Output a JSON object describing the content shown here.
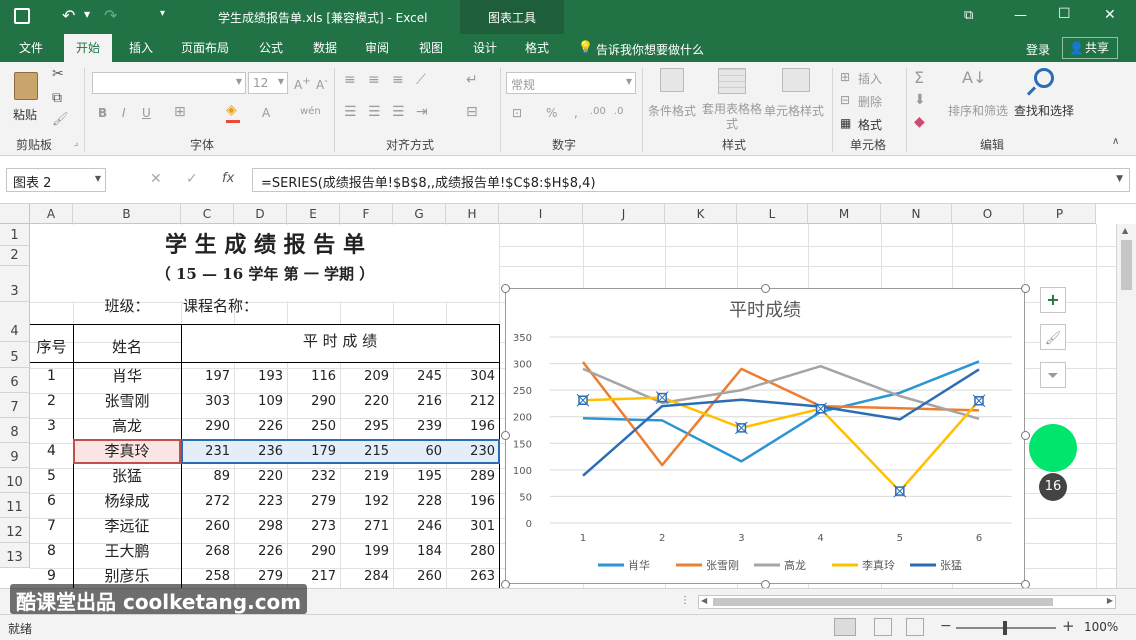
{
  "window": {
    "title": "学生成绩报告单.xls  [兼容模式] - Excel",
    "context_tab": "图表工具",
    "buttons": {
      "restore": "⧉",
      "minimize": "—",
      "maximize": "☐",
      "close": "✕"
    }
  },
  "tabs": [
    "文件",
    "开始",
    "插入",
    "页面布局",
    "公式",
    "数据",
    "审阅",
    "视图",
    "设计",
    "格式"
  ],
  "active_tab": "开始",
  "tell_me": "告诉我你想要做什么",
  "login": "登录",
  "share": "共享",
  "ribbon": {
    "groups": [
      "剪贴板",
      "字体",
      "对齐方式",
      "数字",
      "样式",
      "单元格",
      "编辑"
    ],
    "paste": "粘贴",
    "font_size": "12",
    "number_format": "常规",
    "cond_format": "条件格式",
    "table_format": "套用表格格式",
    "cell_style": "单元格样式",
    "insert": "插入",
    "delete": "删除",
    "format": "格式",
    "sort_filter": "排序和筛选",
    "find_select": "查找和选择",
    "bold": "B",
    "italic": "I",
    "underline": "U",
    "wen": "wén",
    "font_a": "A",
    "percent": "%"
  },
  "formula_bar": {
    "name_box": "图表 2",
    "fx": "fx",
    "formula": "=SERIES(成绩报告单!$B$8,,成绩报告单!$C$8:$H$8,4)"
  },
  "columns": [
    "A",
    "B",
    "C",
    "D",
    "E",
    "F",
    "G",
    "H",
    "I",
    "J",
    "K",
    "L",
    "M",
    "N",
    "O",
    "P"
  ],
  "rows": [
    "1",
    "2",
    "3",
    "4",
    "5",
    "6",
    "7",
    "8",
    "9",
    "10",
    "11",
    "12",
    "13"
  ],
  "sheet": {
    "title": "学 生 成 绩 报 告 单",
    "subtitle": "（ 15 — 16    学年 第 一 学期 ）",
    "class_label": "班级：",
    "course_label": "课程名称：",
    "hdr_index": "序号",
    "hdr_name": "姓名",
    "hdr_scores": "平 时 成 绩",
    "students": [
      {
        "no": "1",
        "name": "肖华",
        "scores": [
          "197",
          "193",
          "116",
          "209",
          "245",
          "304"
        ]
      },
      {
        "no": "2",
        "name": "张雪刚",
        "scores": [
          "303",
          "109",
          "290",
          "220",
          "216",
          "212"
        ]
      },
      {
        "no": "3",
        "name": "高龙",
        "scores": [
          "290",
          "226",
          "250",
          "295",
          "239",
          "196"
        ]
      },
      {
        "no": "4",
        "name": "李真玲",
        "scores": [
          "231",
          "236",
          "179",
          "215",
          "60",
          "230"
        ]
      },
      {
        "no": "5",
        "name": "张猛",
        "scores": [
          "89",
          "220",
          "232",
          "219",
          "195",
          "289"
        ]
      },
      {
        "no": "6",
        "name": "杨绿成",
        "scores": [
          "272",
          "223",
          "279",
          "192",
          "228",
          "196"
        ]
      },
      {
        "no": "7",
        "name": "李远征",
        "scores": [
          "260",
          "298",
          "273",
          "271",
          "246",
          "301"
        ]
      },
      {
        "no": "8",
        "name": "王大鹏",
        "scores": [
          "268",
          "226",
          "290",
          "199",
          "184",
          "280"
        ]
      },
      {
        "no": "9",
        "name": "别彦乐",
        "scores": [
          "258",
          "279",
          "217",
          "284",
          "260",
          "263"
        ]
      }
    ]
  },
  "chart_data": {
    "type": "line",
    "title": "平时成绩",
    "x": [
      1,
      2,
      3,
      4,
      5,
      6
    ],
    "ylim": [
      0,
      350
    ],
    "yticks": [
      0,
      50,
      100,
      150,
      200,
      250,
      300,
      350
    ],
    "grid": true,
    "legend": "bottom",
    "selected_series": "李真玲",
    "series": [
      {
        "name": "肖华",
        "color": "#2e95d3",
        "values": [
          197,
          193,
          116,
          209,
          245,
          304
        ]
      },
      {
        "name": "张雪刚",
        "color": "#ed7d31",
        "values": [
          303,
          109,
          290,
          220,
          216,
          212
        ]
      },
      {
        "name": "高龙",
        "color": "#a5a5a5",
        "values": [
          290,
          226,
          250,
          295,
          239,
          196
        ]
      },
      {
        "name": "李真玲",
        "color": "#ffc000",
        "values": [
          231,
          236,
          179,
          215,
          60,
          230
        ]
      },
      {
        "name": "张猛",
        "color": "#2a6db5",
        "values": [
          89,
          220,
          232,
          219,
          195,
          289
        ]
      }
    ]
  },
  "badge": "16",
  "status": {
    "ready": "就绪",
    "zoom": "100%"
  },
  "watermark": "酷课堂出品 coolketang.com",
  "colors": {
    "excel_green": "#217346",
    "accent_green": "#00e56b"
  }
}
